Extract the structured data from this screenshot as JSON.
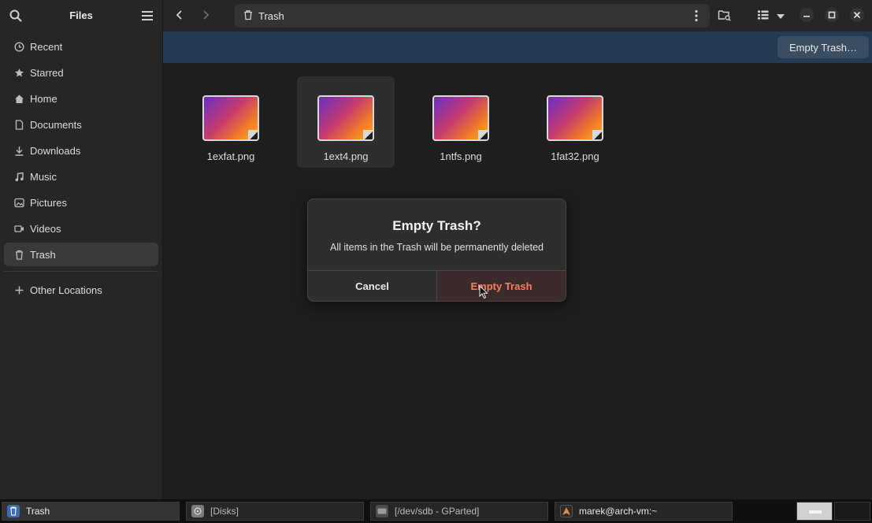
{
  "app": {
    "title": "Files"
  },
  "sidebar": {
    "items": [
      {
        "label": "Recent",
        "icon": "clock-icon"
      },
      {
        "label": "Starred",
        "icon": "star-icon"
      },
      {
        "label": "Home",
        "icon": "home-icon"
      },
      {
        "label": "Documents",
        "icon": "document-icon"
      },
      {
        "label": "Downloads",
        "icon": "download-icon"
      },
      {
        "label": "Music",
        "icon": "music-icon"
      },
      {
        "label": "Pictures",
        "icon": "picture-icon"
      },
      {
        "label": "Videos",
        "icon": "video-icon"
      },
      {
        "label": "Trash",
        "icon": "trash-icon",
        "active": true
      }
    ],
    "other": {
      "label": "Other Locations",
      "icon": "plus-icon"
    }
  },
  "pathbar": {
    "location": "Trash"
  },
  "infobar": {
    "empty_button": "Empty Trash…"
  },
  "files": [
    {
      "name": "1exfat.png"
    },
    {
      "name": "1ext4.png",
      "selected": true
    },
    {
      "name": "1ntfs.png"
    },
    {
      "name": "1fat32.png"
    }
  ],
  "dialog": {
    "title": "Empty Trash?",
    "body": "All items in the Trash will be permanently deleted",
    "cancel": "Cancel",
    "confirm": "Empty Trash"
  },
  "taskbar": {
    "tasks": [
      {
        "label": "Trash",
        "active": true
      },
      {
        "label": "[Disks]"
      },
      {
        "label": "[/dev/sdb - GParted]"
      },
      {
        "label": "marek@arch-vm:~"
      }
    ]
  },
  "colors": {
    "accent_bar": "#223a52",
    "destructive": "#ff7b63"
  }
}
